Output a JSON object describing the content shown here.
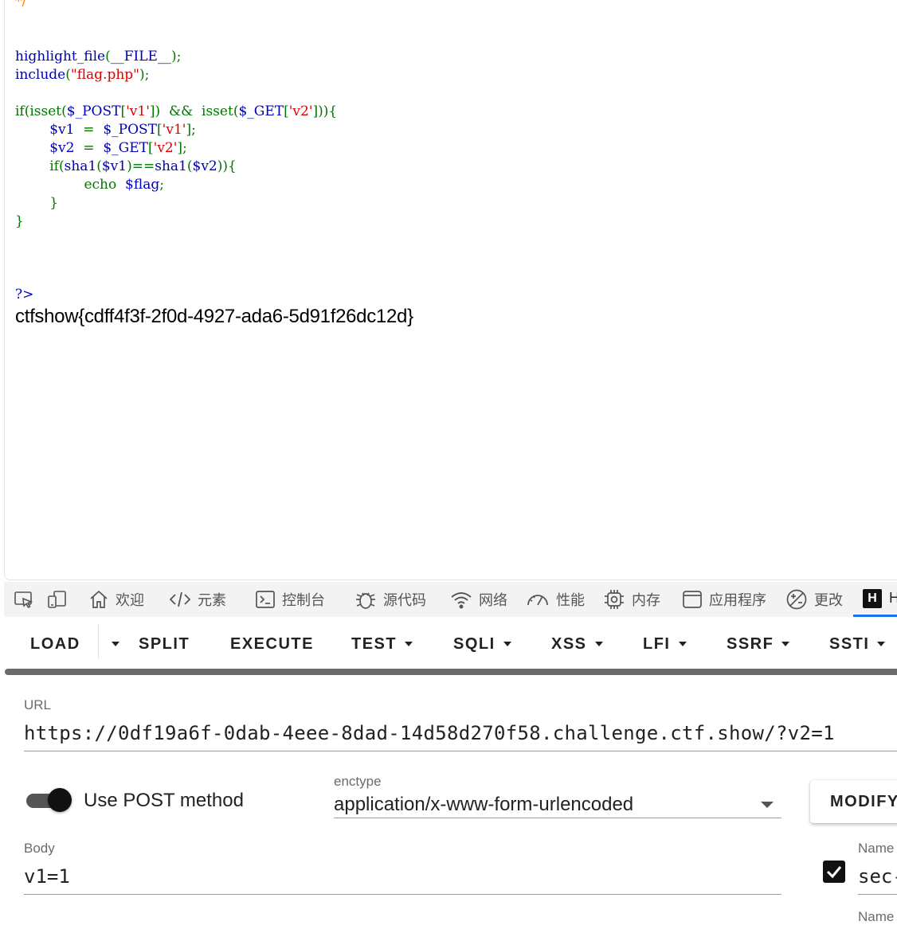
{
  "page": {
    "code_lines": [
      [
        [
          "c-comment",
          "*/"
        ]
      ],
      [],
      [],
      [
        [
          "c-def",
          "highlight_file"
        ],
        [
          "c-kw",
          "("
        ],
        [
          "c-def",
          "__FILE__"
        ],
        [
          "c-kw",
          ");"
        ]
      ],
      [
        [
          "c-def",
          "include"
        ],
        [
          "c-kw",
          "("
        ],
        [
          "c-str",
          "\"flag.php\""
        ],
        [
          "c-kw",
          ");"
        ]
      ],
      [],
      [
        [
          "c-kw",
          "if(isset("
        ],
        [
          "c-def",
          "$_POST"
        ],
        [
          "c-kw",
          "["
        ],
        [
          "c-str",
          "'v1'"
        ],
        [
          "c-kw",
          "])  &&  isset("
        ],
        [
          "c-def",
          "$_GET"
        ],
        [
          "c-kw",
          "["
        ],
        [
          "c-str",
          "'v2'"
        ],
        [
          "c-kw",
          "])){"
        ]
      ],
      [
        [
          "c-kw",
          "        "
        ],
        [
          "c-def",
          "$v1  "
        ],
        [
          "c-kw",
          "=  "
        ],
        [
          "c-def",
          "$_POST"
        ],
        [
          "c-kw",
          "["
        ],
        [
          "c-str",
          "'v1'"
        ],
        [
          "c-kw",
          "];"
        ]
      ],
      [
        [
          "c-kw",
          "        "
        ],
        [
          "c-def",
          "$v2  "
        ],
        [
          "c-kw",
          "=  "
        ],
        [
          "c-def",
          "$_GET"
        ],
        [
          "c-kw",
          "["
        ],
        [
          "c-str",
          "'v2'"
        ],
        [
          "c-kw",
          "];"
        ]
      ],
      [
        [
          "c-kw",
          "        if("
        ],
        [
          "c-def",
          "sha1"
        ],
        [
          "c-kw",
          "("
        ],
        [
          "c-def",
          "$v1"
        ],
        [
          "c-kw",
          ")=="
        ],
        [
          "c-def",
          "sha1"
        ],
        [
          "c-kw",
          "("
        ],
        [
          "c-def",
          "$v2"
        ],
        [
          "c-kw",
          ")){"
        ]
      ],
      [
        [
          "c-kw",
          "                echo  "
        ],
        [
          "c-def",
          "$flag"
        ],
        [
          "c-kw",
          ";"
        ]
      ],
      [
        [
          "c-kw",
          "        }"
        ]
      ],
      [
        [
          "c-kw",
          "}"
        ]
      ],
      [],
      [],
      [],
      [
        [
          "c-def",
          "?>"
        ]
      ]
    ],
    "flag_output": "ctfshow{cdff4f3f-2f0d-4927-ada6-5d91f26dc12d}"
  },
  "devtools": {
    "tabs": [
      {
        "icon": "house-icon",
        "label": "欢迎"
      },
      {
        "icon": "code-icon",
        "label": "元素"
      },
      {
        "icon": "console-icon",
        "label": "控制台"
      },
      {
        "icon": "bug-icon",
        "label": "源代码"
      },
      {
        "icon": "wifi-icon",
        "label": "网络"
      },
      {
        "icon": "gauge-icon",
        "label": "性能"
      },
      {
        "icon": "chip-icon",
        "label": "内存"
      },
      {
        "icon": "window-icon",
        "label": "应用程序"
      },
      {
        "icon": "changes-icon",
        "label": "更改"
      },
      {
        "icon": "hackbar-icon",
        "label": "H"
      }
    ]
  },
  "hackbar": {
    "menu": {
      "load": "LOAD",
      "split": "SPLIT",
      "execute": "EXECUTE",
      "test": "TEST",
      "sqli": "SQLI",
      "xss": "XSS",
      "lfi": "LFI",
      "ssrf": "SSRF",
      "ssti": "SSTI"
    },
    "url_label": "URL",
    "url_value": "https://0df19a6f-0dab-4eee-8dad-14d58d270f58.challenge.ctf.show/?v2=1",
    "use_post_label": "Use POST method",
    "use_post_enabled": true,
    "enctype_label": "enctype",
    "enctype_value": "application/x-www-form-urlencoded",
    "modify_button": "MODIFY",
    "body_label": "Body",
    "body_value": "v1=1",
    "header_name_label": "Name",
    "header_name_value": "sec-",
    "header_name_label_2": "Name",
    "header_checkbox_checked": true
  }
}
